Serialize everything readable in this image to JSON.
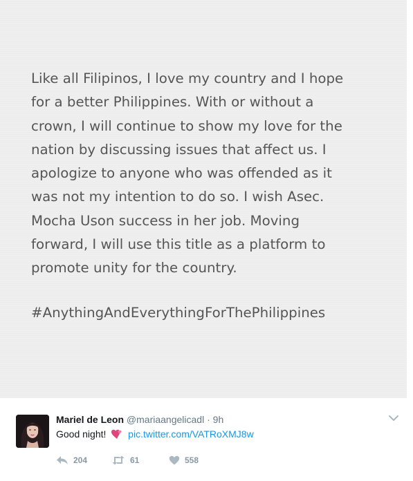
{
  "image_statement": {
    "lines": [
      "Like all Filipinos, I love my country and I hope",
      "for a better Philippines. With or without a",
      "crown, I will continue to show my love for the",
      "nation by discussing issues that affect us. I",
      "apologize to anyone who was offended as it",
      "was not my intention to do so. I wish Asec.",
      "Mocha Uson success in her job. Moving",
      "forward, I will use this title as a platform to",
      "promote unity for the country."
    ],
    "hashtag": "#AnythingAndEverythingForThePhilippines"
  },
  "tweet": {
    "display_name": "Mariel de Leon",
    "handle": "@mariaangelicadl",
    "separator": "·",
    "time": "9h",
    "text": "Good night!",
    "link": "pic.twitter.com/VATRoXMJ8w",
    "avatar_icon": "profile-photo",
    "emoji_icon": "two-hearts-icon",
    "caret_icon": "chevron-down-icon",
    "actions": {
      "reply": {
        "icon": "reply-icon",
        "count": "204"
      },
      "retweet": {
        "icon": "retweet-icon",
        "count": "61"
      },
      "like": {
        "icon": "heart-icon",
        "count": "558"
      }
    }
  },
  "colors": {
    "image_background": "#efefef",
    "statement_text": "#555555",
    "link": "#1b95e0",
    "muted": "#8899a6",
    "emoji": "#e0457b"
  }
}
